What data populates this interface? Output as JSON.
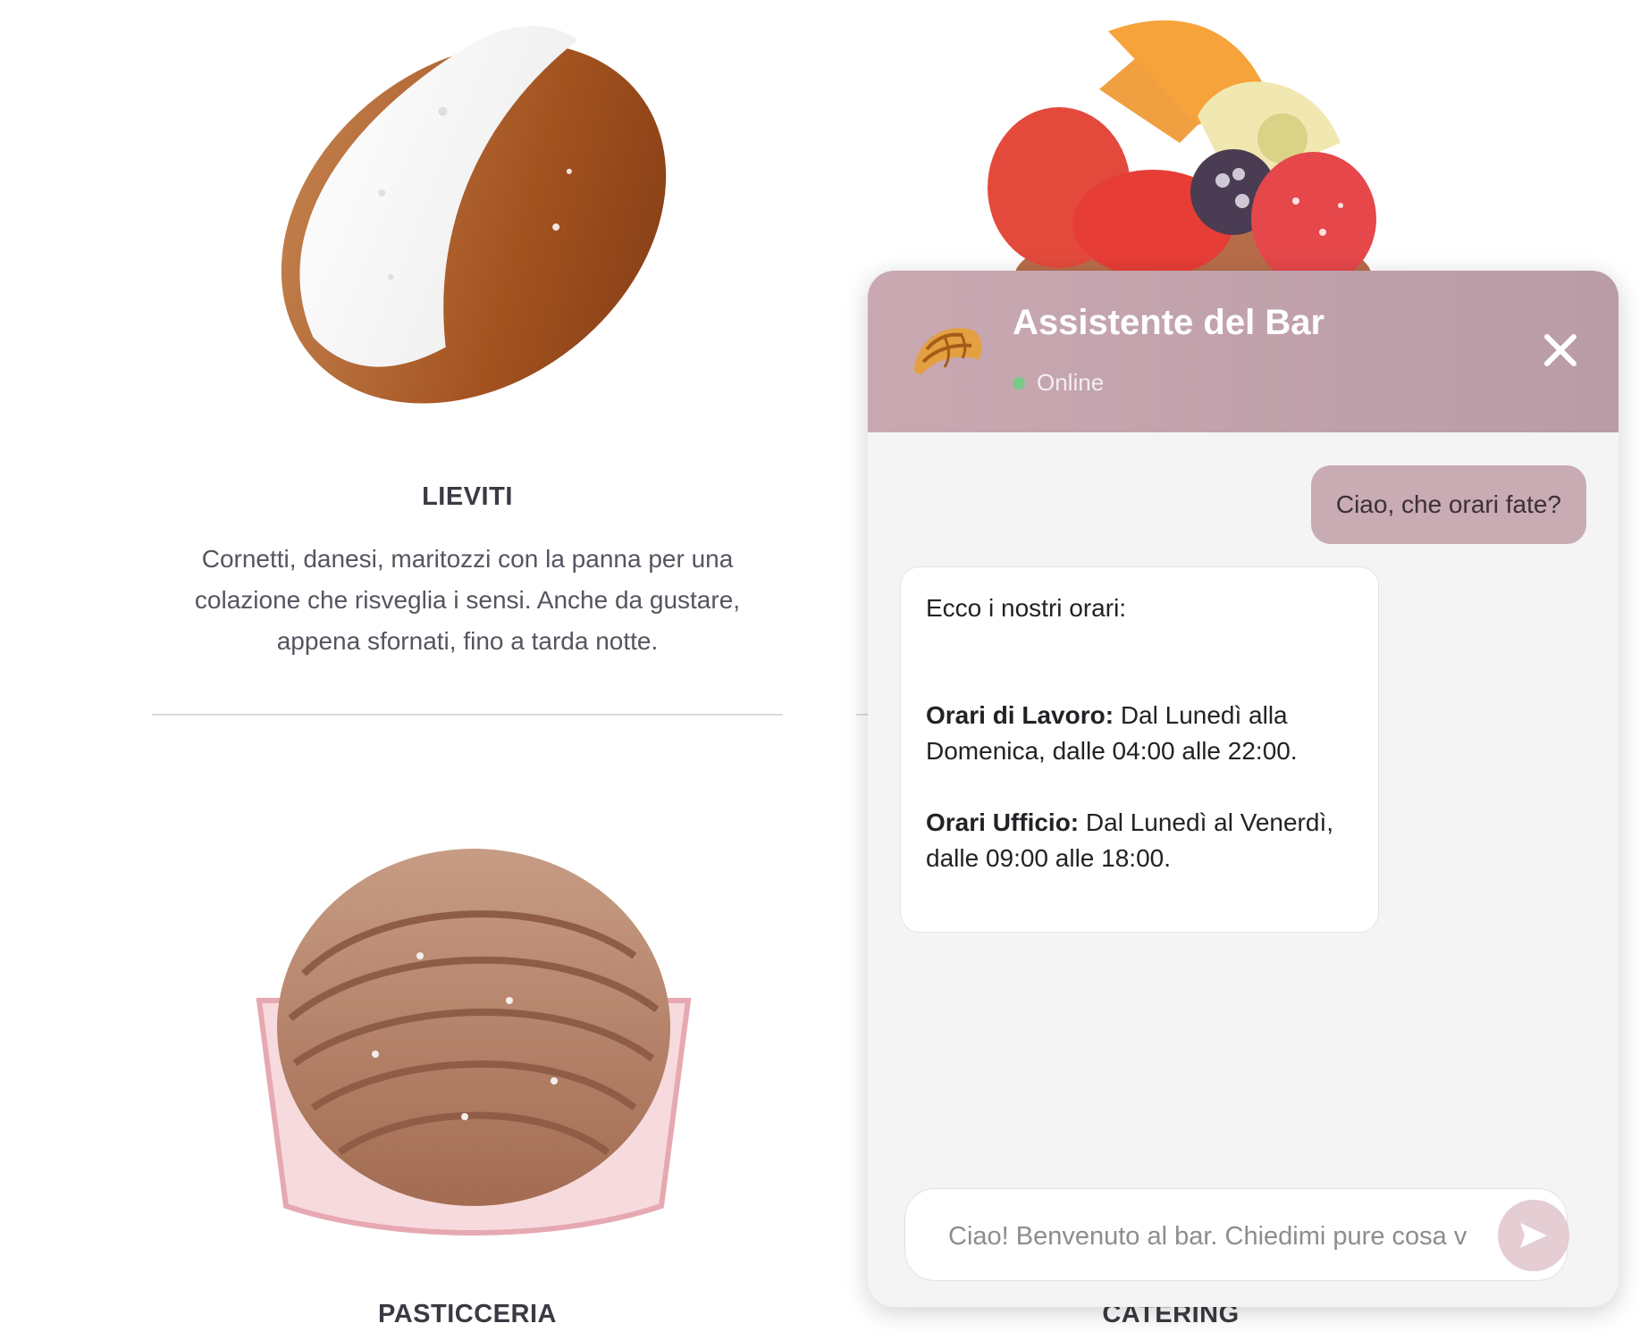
{
  "sections": {
    "lieviti": {
      "title": "LIEVITI",
      "description": "Cornetti, danesi, maritozzi con la panna per una colazione che risveglia i sensi. Anche da gustare, appena sfornati, fino a tarda notte."
    },
    "pasticceria": {
      "title": "PASTICCERIA"
    },
    "catering": {
      "title": "CATERING"
    }
  },
  "chat": {
    "title": "Assistente del Bar",
    "status": "Online",
    "status_color": "#79c98a",
    "header_color": "#c3a4ad",
    "avatar_icon": "croissant-icon",
    "close_icon": "close-icon",
    "send_icon": "send-icon",
    "messages": {
      "user_question": "Ciao, che orari fate?",
      "bot_intro": "Ecco i nostri orari:",
      "work_label": "Orari di Lavoro:",
      "work_text": "Dal Lunedì alla Domenica, dalle 04:00 alle 22:00.",
      "office_label": "Orari Ufficio:",
      "office_text": "Dal Lunedì al Venerdì, dalle 09:00 alle 18:00."
    },
    "input": {
      "placeholder": "Ciao! Benvenuto al bar. Chiedimi pure cosa vuoi sapere",
      "value": ""
    }
  }
}
